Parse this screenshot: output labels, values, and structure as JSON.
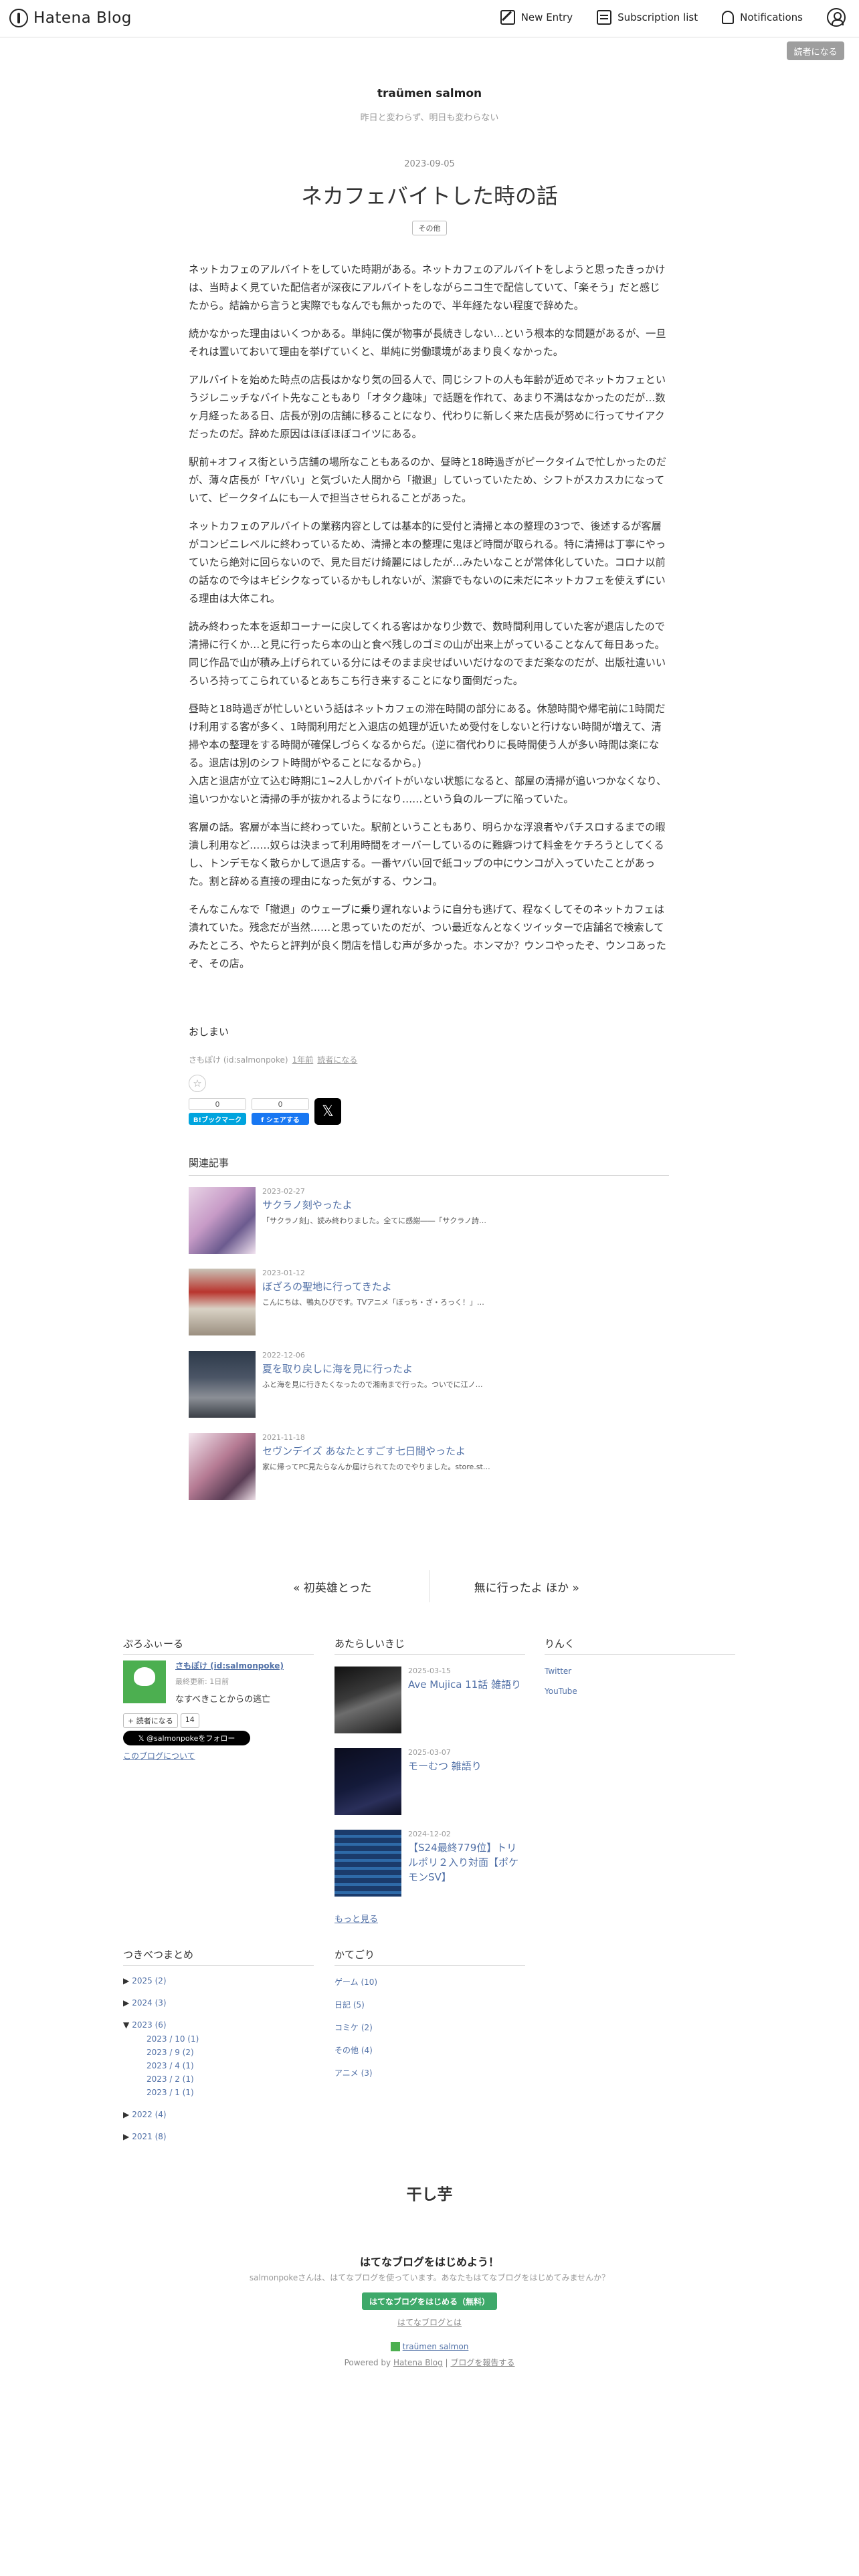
{
  "header": {
    "brand": "Hatena Blog",
    "nav": [
      {
        "label": "New Entry",
        "icon": "pen-icon"
      },
      {
        "label": "Subscription list",
        "icon": "book-icon"
      },
      {
        "label": "Notifications",
        "icon": "bell-icon"
      }
    ],
    "reader_button": "読者になる"
  },
  "blog": {
    "title": "traümen salmon",
    "description": "昨日と変わらず、明日も変わらない"
  },
  "article": {
    "date": "2023-09-05",
    "title": "ネカフェバイトした時の話",
    "category": "その他",
    "paragraphs": [
      "ネットカフェのアルバイトをしていた時期がある。ネットカフェのアルバイトをしようと思ったきっかけは、当時よく見ていた配信者が深夜にアルバイトをしながらニコ生で配信していて、「楽そう」だと感じたから。結論から言うと実際でもなんでも無かったので、半年経たない程度で辞めた。",
      "続かなかった理由はいくつかある。単純に僕が物事が長続きしない…という根本的な問題があるが、一旦それは置いておいて理由を挙げていくと、単純に労働環境があまり良くなかった。",
      "アルバイトを始めた時点の店長はかなり気の回る人で、同じシフトの人も年齢が近めでネットカフェというジレニッチなバイト先なこともあり「オタク趣味」で話題を作れて、あまり不満はなかったのだが…数ヶ月経ったある日、店長が別の店舗に移ることになり、代わりに新しく来た店長が努めに行ってサイアクだったのだ。辞めた原因はほぼほぼコイツにある。",
      "駅前+オフィス街という店舗の場所なこともあるのか、昼時と18時過ぎがピークタイムで忙しかったのだが、薄々店長が「ヤバい」と気づいた人間から「撤退」していっていたため、シフトがスカスカになっていて、ピークタイムにも一人で担当させられることがあった。",
      "ネットカフェのアルバイトの業務内容としては基本的に受付と清掃と本の整理の3つで、後述するが客層がコンビニレベルに終わっているため、清掃と本の整理に鬼ほど時間が取られる。特に清掃は丁寧にやっていたら絶対に回らないので、見た目だけ綺麗にはしたが…みたいなことが常体化していた。コロナ以前の話なので今はキビシクなっているかもしれないが、潔癖でもないのに未だにネットカフェを使えずにいる理由は大体これ。",
      "読み終わった本を返却コーナーに戻してくれる客はかなり少数で、数時間利用していた客が退店したので清掃に行くか…と見に行ったら本の山と食べ残しのゴミの山が出来上がっていることなんて毎日あった。同じ作品で山が積み上げられている分にはそのまま戻せばいいだけなのでまだ楽なのだが、出版社違いいろいろ持ってこられているとあちこち行き来することになり面倒だった。",
      "昼時と18時過ぎが忙しいという話はネットカフェの滞在時間の部分にある。休憩時間や帰宅前に1時間だけ利用する客が多く、1時間利用だと入退店の処理が近いため受付をしないと行けない時間が増えて、清掃や本の整理をする時間が確保しづらくなるからだ。(逆に宿代わりに長時間使う人が多い時間は楽になる。退店は別のシフト時間がやることになるから。)\n入店と退店が立て込む時期に1~2人しかバイトがいない状態になると、部屋の清掃が追いつかなくなり、追いつかないと清掃の手が抜かれるようになり……という負のループに陥っていた。",
      "客層の話。客層が本当に終わっていた。駅前ということもあり、明らかな浮浪者やパチスロするまでの暇潰し利用など……奴らは決まって利用時間をオーバーしているのに難癖つけて料金をケチろうとしてくるし、トンデモなく散らかして退店する。一番ヤバい回で紙コップの中にウンコが入っていたことがあった。割と辞める直接の理由になった気がする、ウンコ。",
      "そんなこんなで「撤退」のウェーブに乗り遅れないように自分も逃げて、程なくしてそのネットカフェは潰れていた。残念だが当然……と思っていたのだが、つい最近なんとなくツイッターで店舗名で検索してみたところ、やたらと評判が良く閉店を惜しむ声が多かった。ホンマか？ウンコやったぞ、ウンコあったぞ、その店。"
    ],
    "outro": "おしまい",
    "byline": {
      "author": "さもぽけ (id:salmonpoke)",
      "time": "1年前",
      "reader": "読者になる"
    },
    "share": {
      "hatena_count": "0",
      "hatena_label": "B!ブックマーク",
      "facebook_count": "0",
      "facebook_label": "f シェアする",
      "x_label": "𝕏"
    }
  },
  "related": {
    "heading": "関連記事",
    "items": [
      {
        "date": "2023-02-27",
        "title": "サクラノ刻やったよ",
        "snippet": "「サクラノ刻」、読み終わりました。全てに感謝――「サクラノ詩…"
      },
      {
        "date": "2023-01-12",
        "title": "ぼざろの聖地に行ってきたよ",
        "snippet": "こんにちは、鴨丸ひびです。TVアニメ「ぼっち・ざ・ろっく！」…"
      },
      {
        "date": "2022-12-06",
        "title": "夏を取り戻しに海を見に行ったよ",
        "snippet": "ふと海を見に行きたくなったので湘南まで行った。ついでに江ノ…"
      },
      {
        "date": "2021-11-18",
        "title": "セヴンデイズ あなたとすごす七日間やったよ",
        "snippet": "家に帰ってPC見たらなんか届けられてたのでやりました。store.st…"
      }
    ]
  },
  "pager": {
    "prev": "« 初英雄とった",
    "next": "無に行ったよ ほか »"
  },
  "profile": {
    "heading": "ぷろふぃーる",
    "name": "さもぽけ (id:salmonpoke)",
    "updated": "最終更新: 1日前",
    "desc": "なすべきことからの逃亡",
    "reader_label": "+ 読者になる",
    "reader_count": "14",
    "x_follow": "𝕏 @salmonpokeをフォロー",
    "about": "このブログについて"
  },
  "recent": {
    "heading": "あたらしいきじ",
    "items": [
      {
        "date": "2025-03-15",
        "title": "Ave Mujica 11話 雑語り"
      },
      {
        "date": "2025-03-07",
        "title": "モーむつ 雑語り"
      },
      {
        "date": "2024-12-02",
        "title": "【S24最終779位】トリルポリ２入り対面【ポケモンSV】"
      }
    ],
    "more": "もっと見る"
  },
  "links": {
    "heading": "りんく",
    "items": [
      "Twitter",
      "YouTube"
    ]
  },
  "archive": {
    "heading": "つきべつまとめ",
    "years": [
      {
        "tri": "▶",
        "label": "2025 (2)"
      },
      {
        "tri": "▶",
        "label": "2024 (3)"
      },
      {
        "tri": "▼",
        "label": "2023 (6)"
      }
    ],
    "months": [
      "2023 / 10 (1)",
      "2023 / 9 (2)",
      "2023 / 4 (1)",
      "2023 / 2 (1)",
      "2023 / 1 (1)"
    ],
    "later_years": [
      {
        "tri": "▶",
        "label": "2022 (4)"
      },
      {
        "tri": "▶",
        "label": "2021 (8)"
      }
    ]
  },
  "categories": {
    "heading": "かてごり",
    "items": [
      "ゲーム (10)",
      "日記 (5)",
      "コミケ (2)",
      "その他 (4)",
      "アニメ (3)"
    ]
  },
  "footer": {
    "title": "干し芋",
    "promo_head": "はてなブログをはじめよう！",
    "promo_sub": "salmonpokeさんは、はてなブログを使っています。あなたもはてなブログをはじめてみませんか？",
    "promo_button": "はてなブログをはじめる（無料）",
    "promo_link": "はてなブログとは",
    "blog_link": "traümen salmon",
    "powered_by": "Powered by",
    "powered_link": "Hatena Blog",
    "sep": "|",
    "report": "ブログを報告する"
  },
  "colors": {
    "link": "#5271a7",
    "hatena_blue": "#00a4de",
    "facebook_blue": "#1877f2",
    "promo_green": "#3ea96a"
  }
}
